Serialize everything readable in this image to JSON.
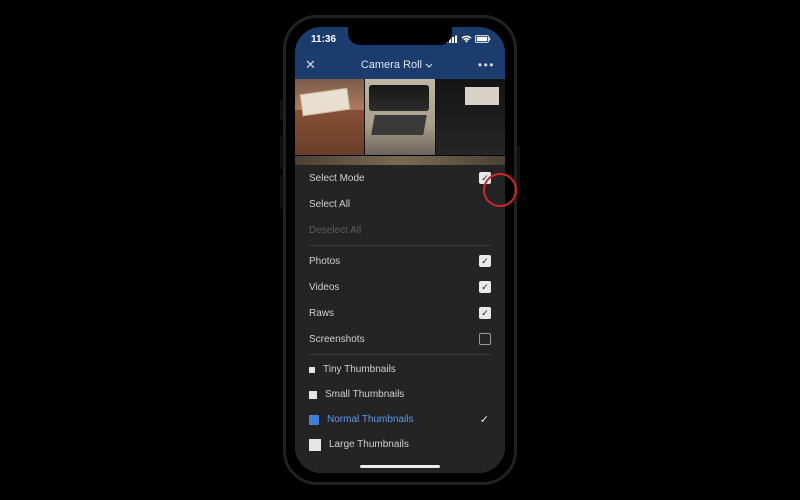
{
  "status": {
    "time": "11:36"
  },
  "nav": {
    "title": "Camera Roll"
  },
  "menu": {
    "select_mode": {
      "label": "Select Mode",
      "checked": true
    },
    "select_all": {
      "label": "Select All"
    },
    "deselect_all": {
      "label": "Deselect All"
    },
    "filters": {
      "photos": {
        "label": "Photos",
        "checked": true
      },
      "videos": {
        "label": "Videos",
        "checked": true
      },
      "raws": {
        "label": "Raws",
        "checked": true
      },
      "screenshots": {
        "label": "Screenshots",
        "checked": false
      }
    },
    "thumb_sizes": {
      "tiny": {
        "label": "Tiny Thumbnails",
        "selected": false
      },
      "small": {
        "label": "Small Thumbnails",
        "selected": false
      },
      "normal": {
        "label": "Normal Thumbnails",
        "selected": true
      },
      "large": {
        "label": "Large Thumbnails",
        "selected": false
      }
    }
  }
}
